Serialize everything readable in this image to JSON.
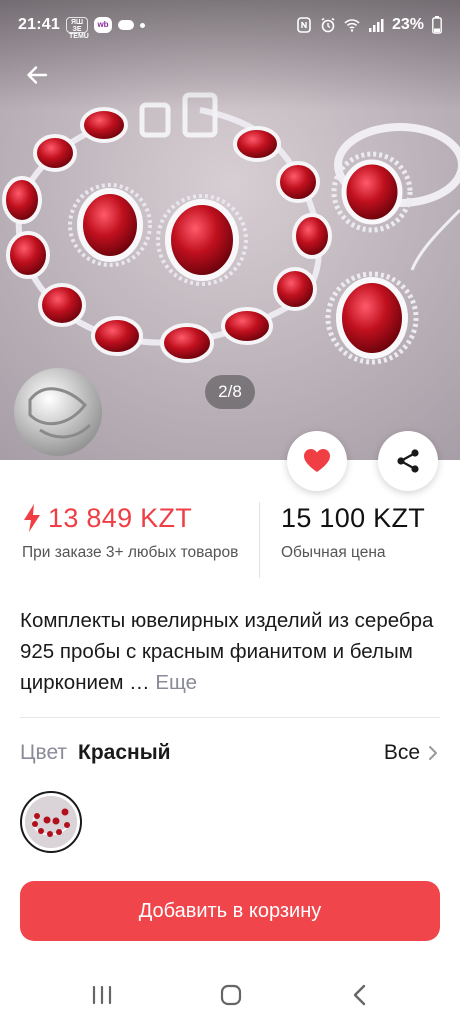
{
  "status_bar": {
    "time": "21:41",
    "apps": [
      "temu",
      "wb"
    ],
    "temu_label": "ЯШ ЗЕ TEMU",
    "wb_label": "wb",
    "battery": "23%",
    "icons": [
      "cloud-icon",
      "notification-dot",
      "nfc-icon",
      "alarm-icon",
      "wifi-icon",
      "signal-icon"
    ]
  },
  "gallery": {
    "counter": "2/8"
  },
  "price": {
    "promo_value": "13 849 KZT",
    "promo_note": "При заказе 3+ любых товаров",
    "regular_value": "15 100 KZT",
    "regular_note": "Обычная цена",
    "accent_color": "#ef3f44"
  },
  "description": {
    "text": "Комплекты ювелирных изделий из серебра 925 пробы с красным фианитом и белым цирконием …",
    "more_label": "Еще"
  },
  "color_option": {
    "label": "Цвет",
    "value": "Красный",
    "all_label": "Все"
  },
  "cart": {
    "button_label": "Добавить в корзину",
    "button_color": "#f0454b"
  }
}
